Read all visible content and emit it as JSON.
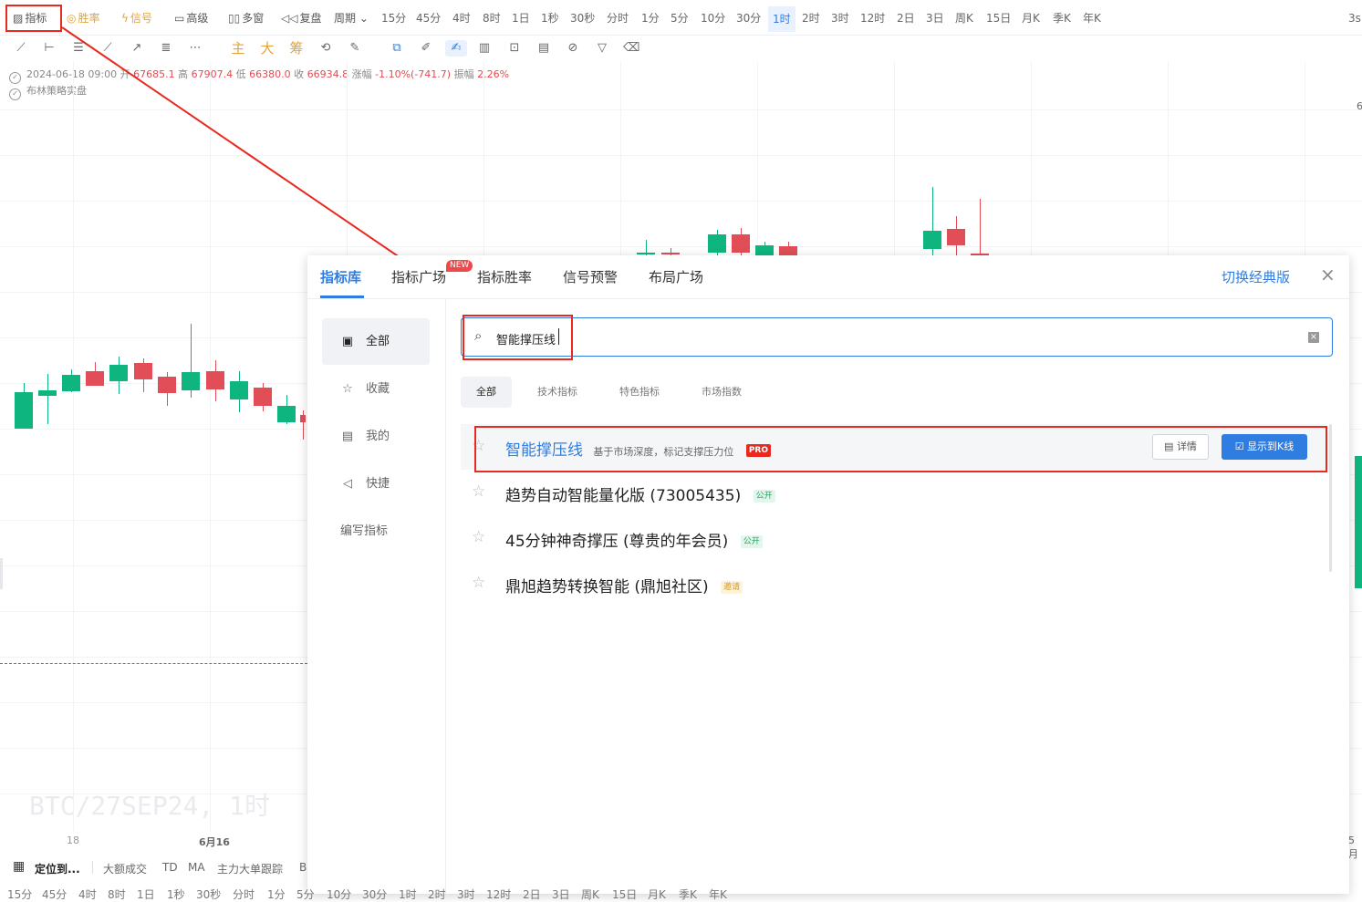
{
  "topbar": {
    "indicator": "指标",
    "winrate": "胜率",
    "signal": "信号",
    "advanced": "高级",
    "multiwin": "多窗",
    "replay": "复盘",
    "period": "周期",
    "periods": [
      "15分",
      "45分",
      "4时",
      "8时",
      "1日",
      "1秒",
      "30秒",
      "分时",
      "1分",
      "5分",
      "10分",
      "30分",
      "1时",
      "2时",
      "3时",
      "12时",
      "2日",
      "3日",
      "周K",
      "15日",
      "月K",
      "季K",
      "年K"
    ],
    "active_period": "1时",
    "right_text": "3s"
  },
  "drawbar": {
    "main": "主",
    "big": "大",
    "chip": "筹"
  },
  "info": {
    "datetime": "2024-06-18 09:00",
    "open_label": "开",
    "open": "67685.1",
    "high_label": "高",
    "high": "67907.4",
    "low_label": "低",
    "low": "66380.0",
    "close_label": "收",
    "close": "66934.8",
    "change_label": "涨幅",
    "change": "-1.10%(-741.7)",
    "amp_label": "振幅",
    "amp": "2.26%",
    "strategy": "布林策略实盘"
  },
  "chart": {
    "watermark": "BTC/27SEP24, 1时",
    "x_labels": [
      "18",
      "6月16"
    ],
    "right_label": "6",
    "right_bottom": "5月",
    "up_color": "#0fb57f",
    "down_color": "#e24e57"
  },
  "modal": {
    "tabs": [
      "指标库",
      "指标广场",
      "指标胜率",
      "信号预警",
      "布局广场"
    ],
    "new_badge": "NEW",
    "switch_label": "切换经典版",
    "sidebar": [
      "全部",
      "收藏",
      "我的",
      "快捷",
      "编写指标"
    ],
    "search_value": "智能撑压线",
    "chips": [
      "全部",
      "技术指标",
      "特色指标",
      "市场指数"
    ],
    "results": [
      {
        "name": "智能撑压线",
        "desc": "基于市场深度，标记支撑压力位",
        "tag": "PRO"
      },
      {
        "name": "趋势自动智能量化版 (73005435)",
        "tag": "公开"
      },
      {
        "name": "45分钟神奇撑压 (尊贵的年会员)",
        "tag": "公开"
      },
      {
        "name": "鼎旭趋势转换智能 (鼎旭社区)",
        "tag": "邀请"
      }
    ],
    "detail_button": "详情",
    "show_button": "显示到K线"
  },
  "bottombar": {
    "locate": "定位到...",
    "indicators": [
      "大额成交",
      "TD",
      "MA",
      "主力大单跟踪",
      "B"
    ]
  },
  "bottom_periods": [
    "15分",
    "45分",
    "4时",
    "8时",
    "1日",
    "1秒",
    "30秒",
    "分时",
    "1分",
    "5分",
    "10分",
    "30分",
    "1时",
    "2时",
    "3时",
    "12时",
    "2日",
    "3日",
    "周K",
    "15日",
    "月K",
    "季K",
    "年K"
  ]
}
